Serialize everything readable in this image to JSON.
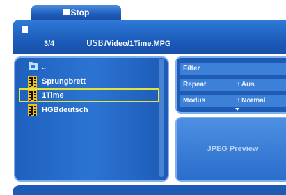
{
  "stop_tab": {
    "label": "Stop"
  },
  "header": {
    "count": "3/4",
    "device": "USB",
    "path": "/Video/1Time.MPG"
  },
  "file_list": {
    "items": [
      {
        "label": "..",
        "icon": "folder-icon",
        "selected": false
      },
      {
        "label": "Sprungbrett",
        "icon": "film-icon",
        "selected": false
      },
      {
        "label": "1Time",
        "icon": "film-icon",
        "selected": true
      },
      {
        "label": "HGBdeutsch",
        "icon": "film-icon",
        "selected": false
      }
    ]
  },
  "info": {
    "filter": {
      "key": "Filter",
      "value": ""
    },
    "repeat": {
      "key": "Repeat",
      "value": ": Aus"
    },
    "modus": {
      "key": "Modus",
      "value": ": Normal"
    }
  },
  "preview": {
    "label": "JPEG Preview"
  },
  "colors": {
    "panel": "#1d5bb7",
    "border": "#7fb0ec",
    "selection": "#e3e33a",
    "film_icon": "#f1c21c"
  }
}
